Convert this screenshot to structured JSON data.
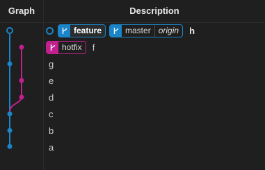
{
  "header": {
    "graph_label": "Graph",
    "description_label": "Description"
  },
  "colors": {
    "blue": "#1a85c8",
    "pink": "#c31f8f",
    "background": "#1f1f1f"
  },
  "rows": [
    {
      "head": true,
      "refs": [
        {
          "name": "feature",
          "color": "blue",
          "current": true
        },
        {
          "name": "master",
          "remote": "origin",
          "color": "blue"
        }
      ],
      "message": "h"
    },
    {
      "refs": [
        {
          "name": "hotfix",
          "color": "pink"
        }
      ],
      "message": "f"
    },
    {
      "message": "g"
    },
    {
      "message": "e"
    },
    {
      "message": "d"
    },
    {
      "message": "c"
    },
    {
      "message": "b"
    },
    {
      "message": "a"
    }
  ],
  "icons": {
    "branch": "branch-icon",
    "head": "head-ring-icon"
  }
}
